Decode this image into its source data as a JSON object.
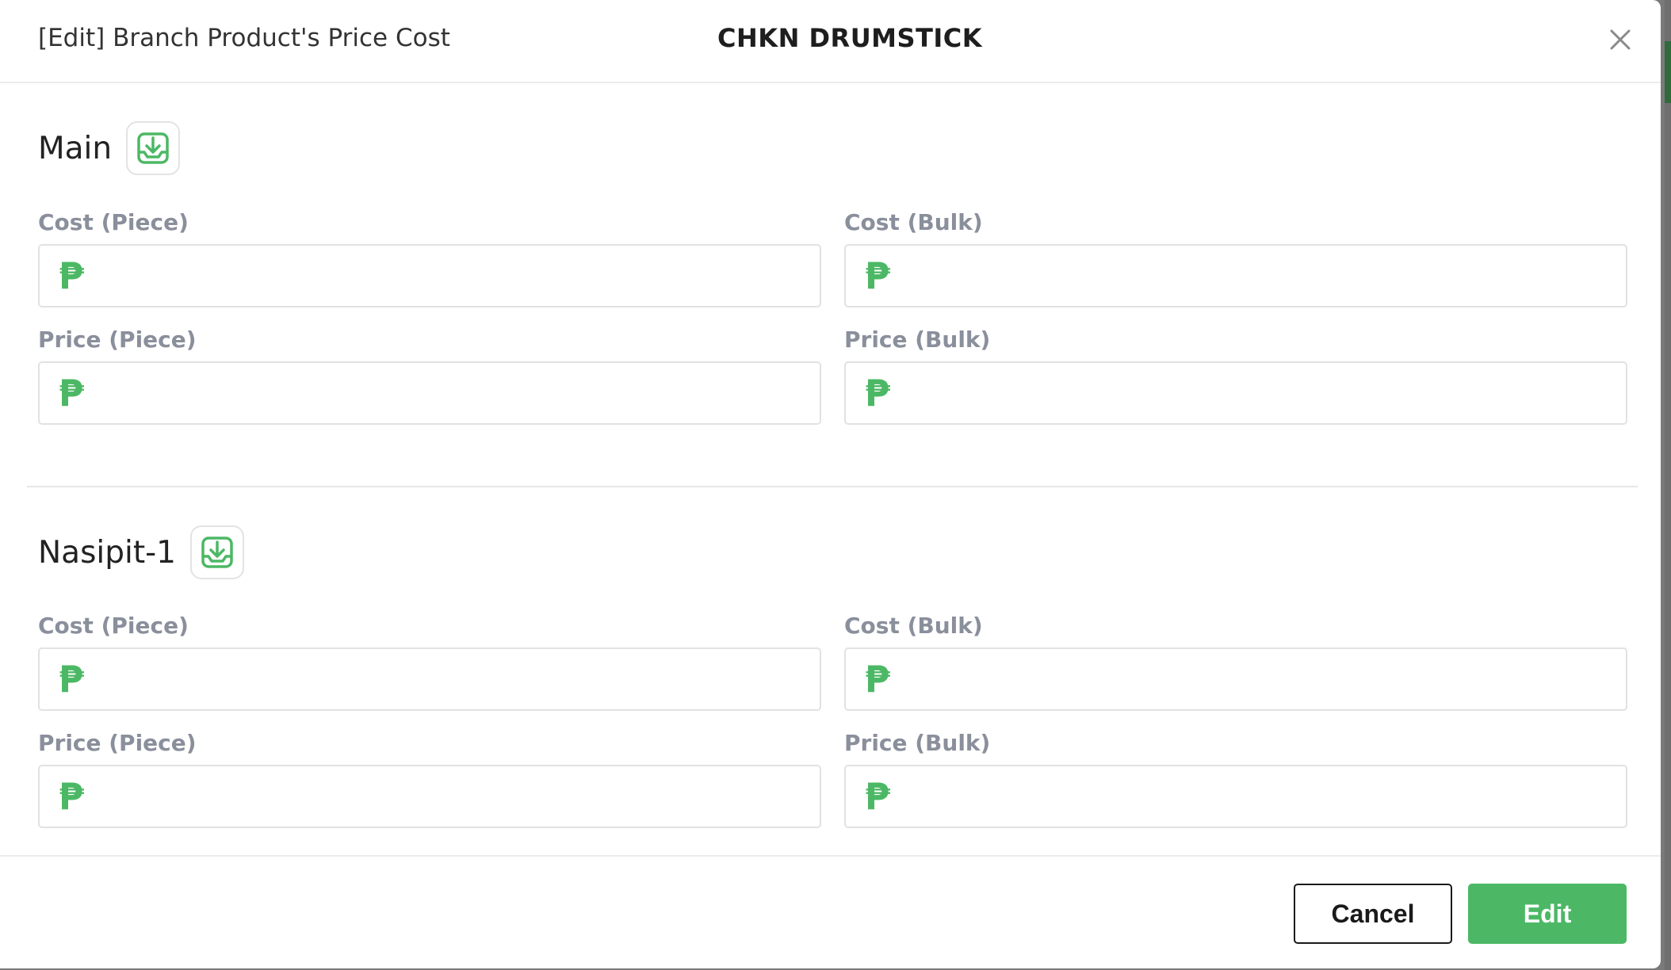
{
  "modal": {
    "title": "[Edit] Branch Product's Price Cost",
    "product_name": "CHKN DRUMSTICK",
    "close_icon": "close-icon"
  },
  "currency_symbol": "₱",
  "branches": [
    {
      "name": "Main",
      "import_icon": "download-tray-icon",
      "fields": {
        "cost_piece": {
          "label": "Cost (Piece)",
          "value": ""
        },
        "cost_bulk": {
          "label": "Cost (Bulk)",
          "value": ""
        },
        "price_piece": {
          "label": "Price (Piece)",
          "value": ""
        },
        "price_bulk": {
          "label": "Price (Bulk)",
          "value": ""
        }
      }
    },
    {
      "name": "Nasipit-1",
      "import_icon": "download-tray-icon",
      "fields": {
        "cost_piece": {
          "label": "Cost (Piece)",
          "value": ""
        },
        "cost_bulk": {
          "label": "Cost (Bulk)",
          "value": ""
        },
        "price_piece": {
          "label": "Price (Piece)",
          "value": ""
        },
        "price_bulk": {
          "label": "Price (Bulk)",
          "value": ""
        }
      }
    }
  ],
  "footer": {
    "cancel_label": "Cancel",
    "edit_label": "Edit"
  },
  "colors": {
    "accent_green": "#4cb865",
    "label_gray": "#8a8f9c"
  }
}
